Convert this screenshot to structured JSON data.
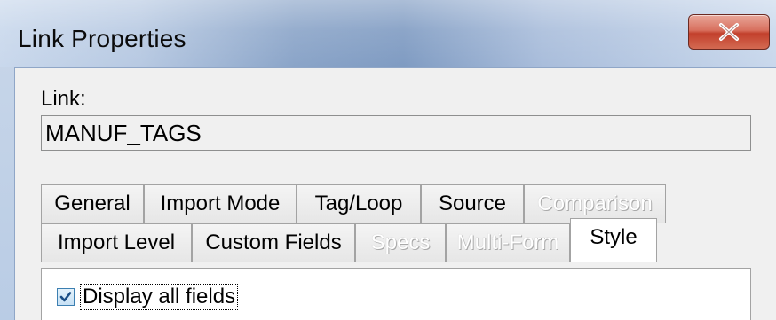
{
  "window": {
    "title": "Link Properties",
    "close_glyph": "X"
  },
  "link": {
    "label": "Link:",
    "value": "MANUF_TAGS"
  },
  "tabs_row1": [
    {
      "label": "General",
      "enabled": true
    },
    {
      "label": "Import Mode",
      "enabled": true
    },
    {
      "label": "Tag/Loop",
      "enabled": true
    },
    {
      "label": "Source",
      "enabled": true
    },
    {
      "label": "Comparison",
      "enabled": false
    }
  ],
  "tabs_row2": [
    {
      "label": "Import Level",
      "enabled": true
    },
    {
      "label": "Custom Fields",
      "enabled": true
    },
    {
      "label": "Specs",
      "enabled": false
    },
    {
      "label": "Multi-Form",
      "enabled": false
    },
    {
      "label": "Style",
      "enabled": true,
      "active": true
    }
  ],
  "style_panel": {
    "display_all_fields_label": "Display all fields",
    "display_all_fields_checked": true
  },
  "colors": {
    "close_button": "#c9432f",
    "checkbox_border": "#3c7fb1"
  }
}
